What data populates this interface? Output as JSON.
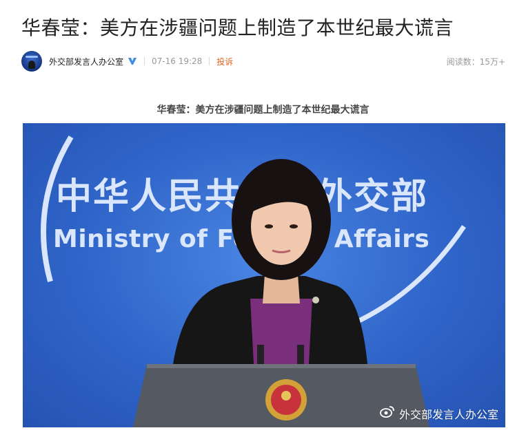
{
  "article": {
    "title": "华春莹：美方在涉疆问题上制造了本世纪最大谎言",
    "caption": "华春莹：美方在涉疆问题上制造了本世纪最大谎言"
  },
  "meta": {
    "author": "外交部发言人办公室",
    "verified_icon": "v-verified-icon",
    "time": "07-16 19:28",
    "report_label": "投诉",
    "reads_label": "阅读数：",
    "reads_value": "15万+"
  },
  "photo": {
    "backdrop_cn": "中华人民共和国外交部",
    "backdrop_en": "Ministry of Foreign Affairs",
    "watermark": "外交部发言人办公室",
    "watermark_icon": "weibo-icon"
  },
  "colors": {
    "report": "#e2621b",
    "verified": "#3b8ee6",
    "photo_bg": "#2f64c8"
  }
}
